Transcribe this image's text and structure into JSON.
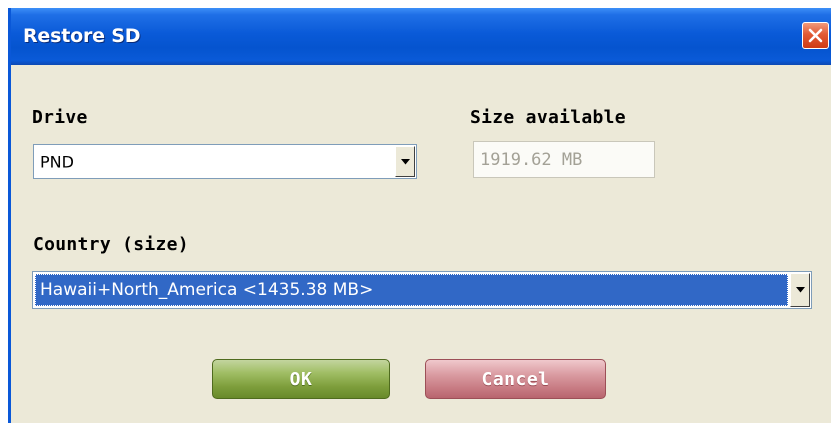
{
  "window": {
    "title": "Restore SD"
  },
  "drive": {
    "label": "Drive",
    "selected": "PND"
  },
  "size_available": {
    "label": "Size available",
    "value": "1919.62 MB"
  },
  "country": {
    "label": "Country (size)",
    "selected": "Hawaii+North_America <1435.38 MB>"
  },
  "buttons": {
    "ok": "OK",
    "cancel": "Cancel"
  },
  "icons": {
    "close": "close-icon",
    "dropdown": "chevron-down-icon"
  },
  "colors": {
    "titlebar": "#0a5ad8",
    "dialog_bg": "#ece9d8",
    "selection": "#3168c6",
    "ok_button": "#9fbd63",
    "cancel_button": "#d99aa0",
    "close_button": "#e15a35"
  }
}
